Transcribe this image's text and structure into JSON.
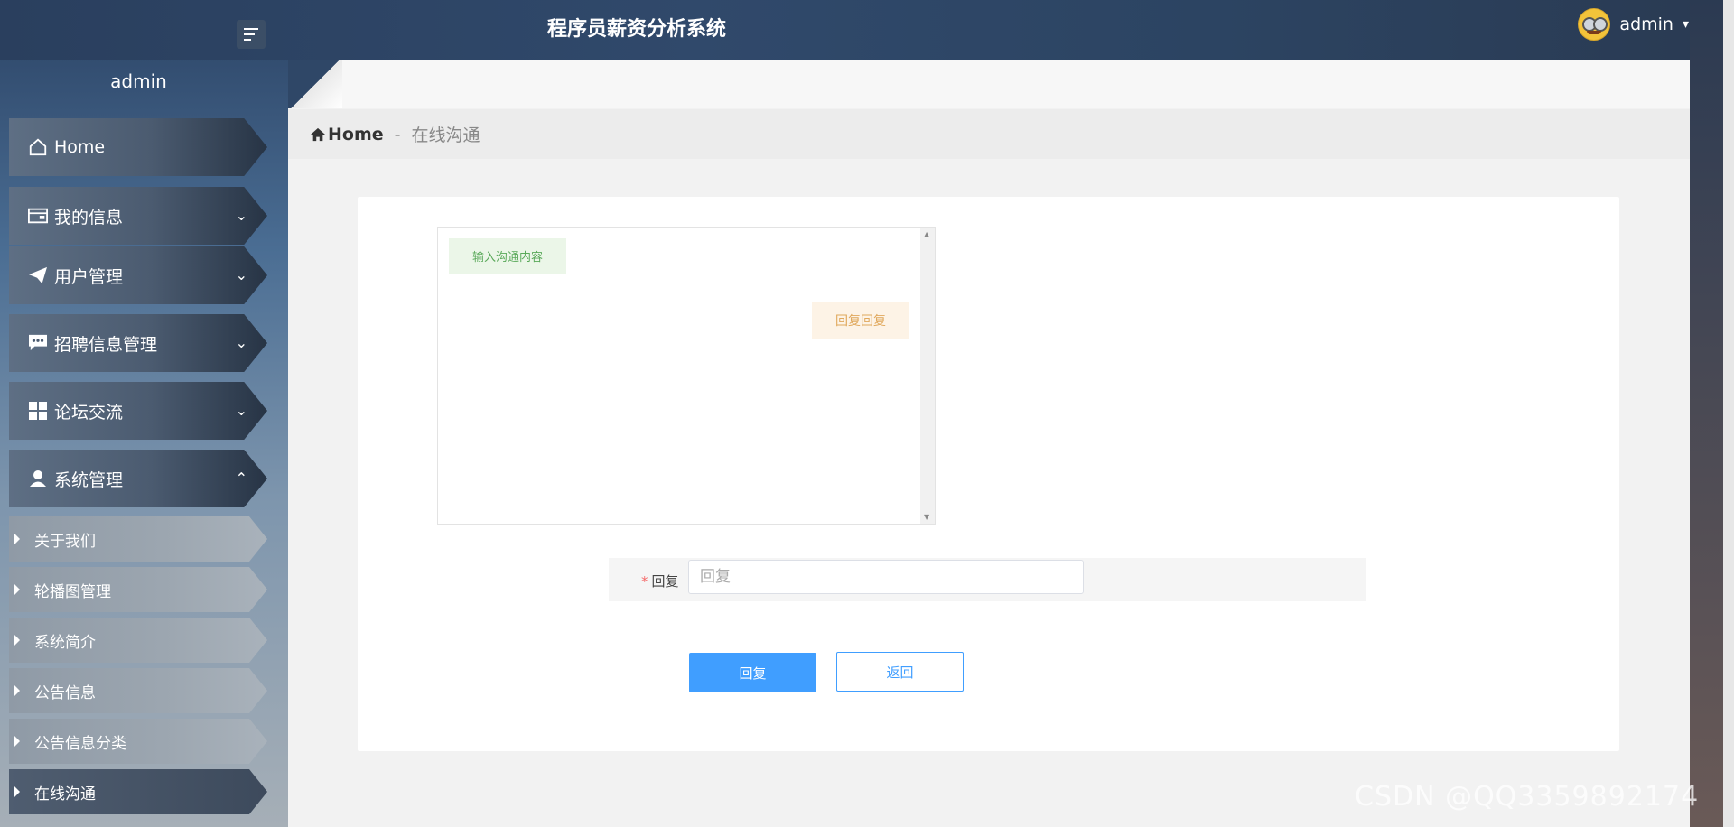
{
  "app": {
    "title": "程序员薪资分析系统"
  },
  "header": {
    "username": "admin",
    "caret": "▾"
  },
  "sidebar": {
    "username": "admin",
    "items": [
      {
        "label": "Home",
        "icon": "home-icon"
      },
      {
        "label": "我的信息",
        "icon": "id-card-icon"
      },
      {
        "label": "用户管理",
        "icon": "paper-plane-icon"
      },
      {
        "label": "招聘信息管理",
        "icon": "comment-icon"
      },
      {
        "label": "论坛交流",
        "icon": "grid-icon"
      },
      {
        "label": "系统管理",
        "icon": "user-icon"
      }
    ],
    "sub_items": [
      {
        "label": "关于我们"
      },
      {
        "label": "轮播图管理"
      },
      {
        "label": "系统简介"
      },
      {
        "label": "公告信息"
      },
      {
        "label": "公告信息分类"
      },
      {
        "label": "在线沟通"
      }
    ]
  },
  "breadcrumb": {
    "home": "Home",
    "separator": "-",
    "current": "在线沟通"
  },
  "chat": {
    "messages": [
      {
        "side": "left",
        "text": "输入沟通内容"
      },
      {
        "side": "right",
        "text": "回复回复"
      }
    ]
  },
  "form": {
    "reply_label": "回复",
    "required_mark": "*",
    "reply_placeholder": "回复",
    "reply_value": ""
  },
  "buttons": {
    "reply": "回复",
    "back": "返回"
  },
  "watermark": "CSDN @QQ3359892174",
  "colors": {
    "primary": "#409eff",
    "chat_left_bg": "#ebf6e8",
    "chat_right_bg": "#fdf3e6"
  }
}
